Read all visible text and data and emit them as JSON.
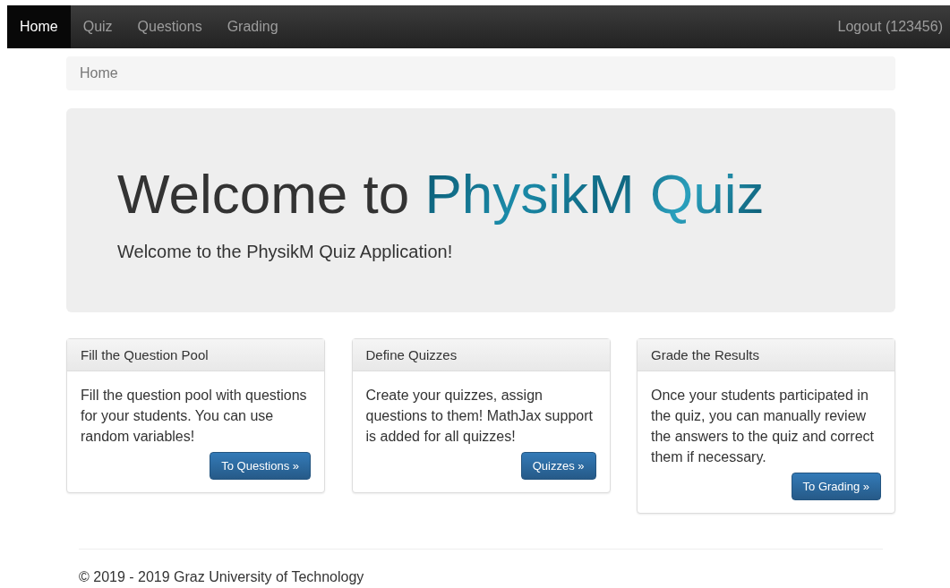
{
  "navbar": {
    "items": [
      {
        "label": "Home",
        "selected": true
      },
      {
        "label": "Quiz",
        "selected": false
      },
      {
        "label": "Questions",
        "selected": false
      },
      {
        "label": "Grading",
        "selected": false
      }
    ],
    "logout": "Logout (123456)"
  },
  "breadcrumb": [
    "Home"
  ],
  "jumbotron": {
    "title": "Welcome to",
    "title_highlight": "PhysikM Quiz",
    "lead": "Welcome to the PhysikM Quiz Application!"
  },
  "panels": [
    {
      "heading": "Fill the Question Pool",
      "body": "Fill the question pool with questions for your students. You can use random variables!",
      "button": "To Questions »"
    },
    {
      "heading": "Define Quizzes",
      "body": "Create your quizzes, assign questions to them! MathJax support is added for all quizzes!",
      "button": "Quizzes »"
    },
    {
      "heading": "Grade the Results",
      "body": "Once your students participated in the quiz, you can manually review the answers to the quiz and correct them if necessary.",
      "button": "To Grading »"
    }
  ],
  "footer": "© 2019 - 2019 Graz University of Technology"
}
